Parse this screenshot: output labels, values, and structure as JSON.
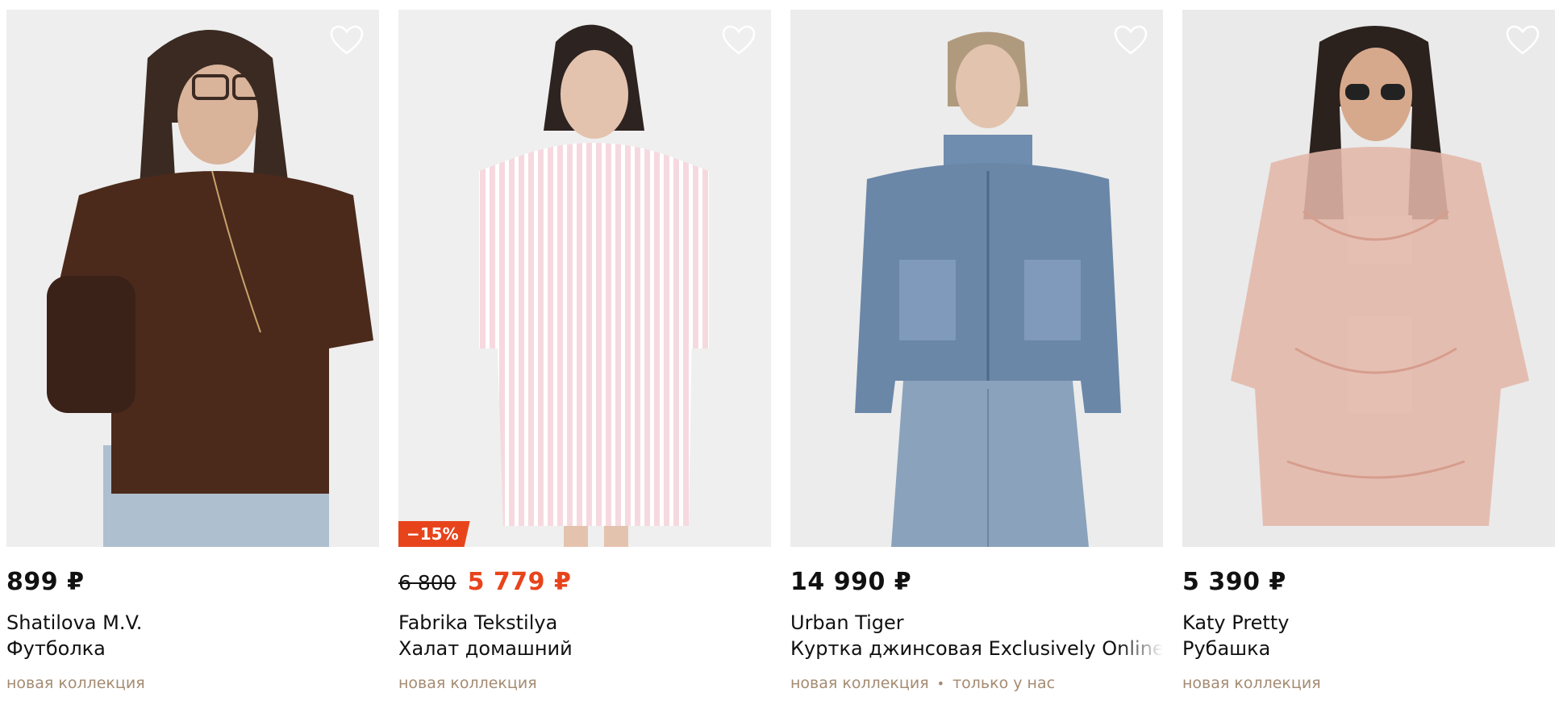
{
  "products": [
    {
      "price": "899 ₽",
      "brand": "Shatilova M.V.",
      "title": "Футболка",
      "tags": [
        "новая коллекция"
      ]
    },
    {
      "old_price": "6 800",
      "price": "5 779 ₽",
      "discount": "−15%",
      "brand": "Fabrika Tekstilya",
      "title": "Халат домашний",
      "tags": [
        "новая коллекция"
      ]
    },
    {
      "price": "14 990 ₽",
      "brand": "Urban Tiger",
      "title": "Куртка джинсовая Exclusively Online",
      "tags": [
        "новая коллекция",
        "только у нас"
      ]
    },
    {
      "price": "5 390 ₽",
      "brand": "Katy Pretty",
      "title": "Рубашка",
      "tags": [
        "новая коллекция"
      ]
    }
  ],
  "colors": {
    "sale": "#e8441c",
    "tag": "#a48b72",
    "text": "#111111",
    "photo_bg": "#eeeeee"
  },
  "icons": {
    "favorite": "heart-outline-icon"
  }
}
